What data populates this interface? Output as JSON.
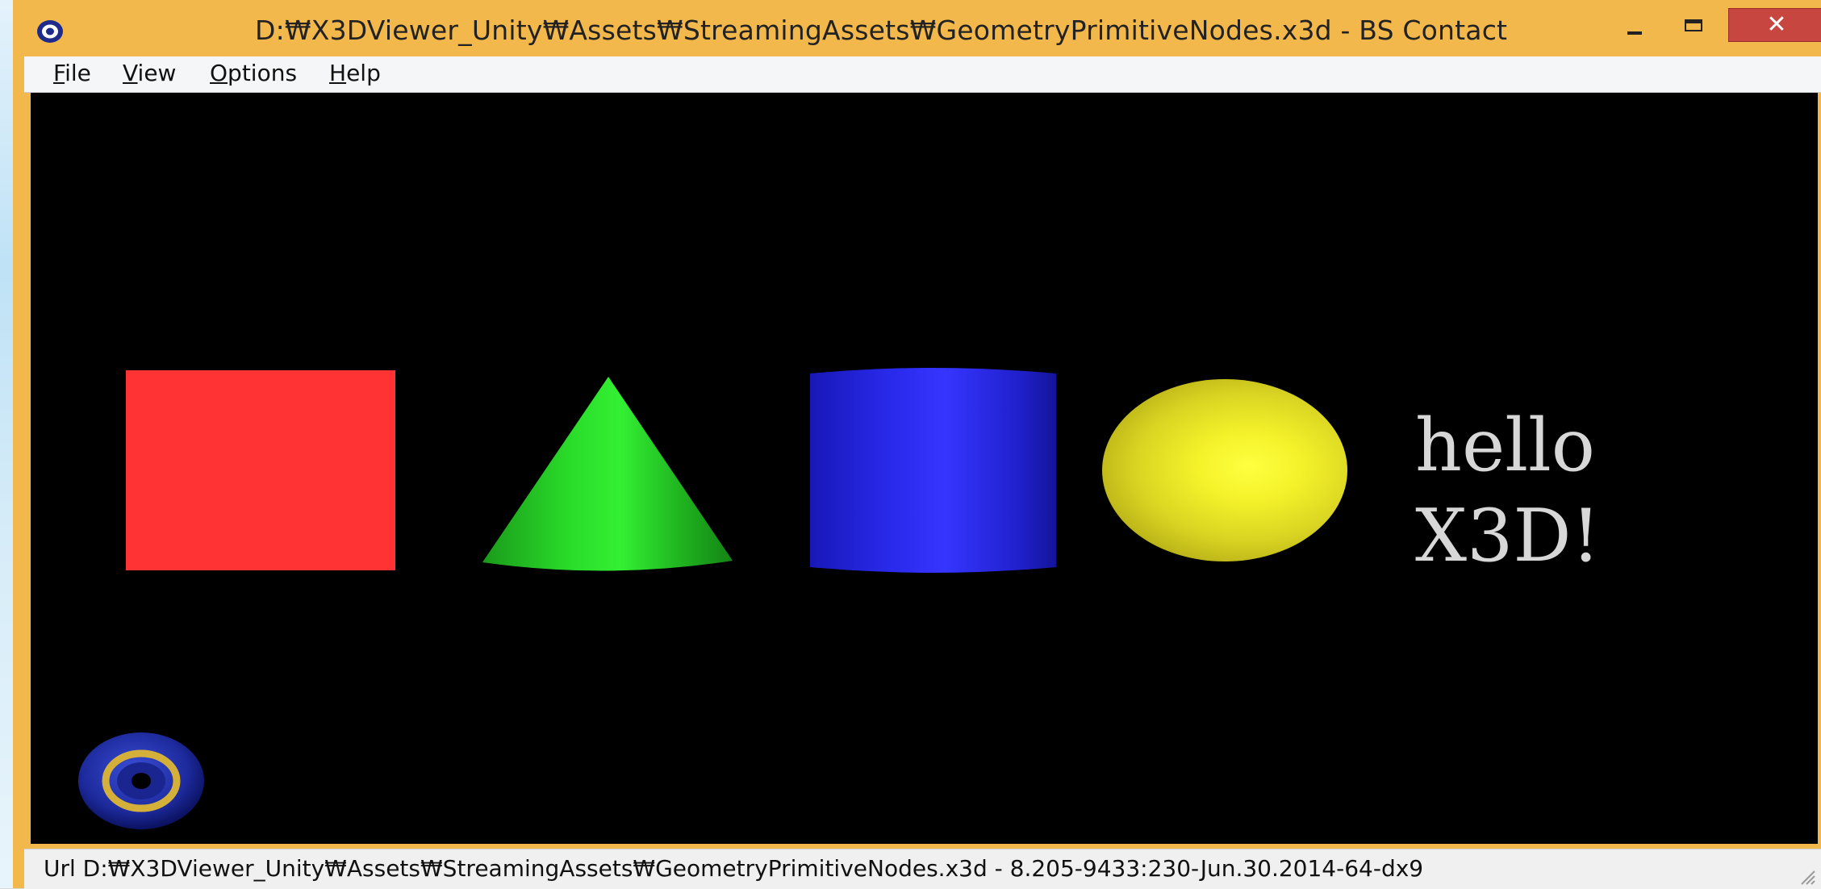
{
  "window": {
    "title": "D:₩X3DViewer_Unity₩Assets₩StreamingAssets₩GeometryPrimitiveNodes.x3d - BS Contact",
    "min_glyph": "−",
    "close_glyph": "✕",
    "app_icon": "bs-contact-eye-icon"
  },
  "menu": {
    "items": [
      {
        "mnemonic": "F",
        "rest": "ile"
      },
      {
        "mnemonic": "V",
        "rest": "iew"
      },
      {
        "mnemonic": "O",
        "rest": "ptions"
      },
      {
        "mnemonic": "H",
        "rest": "elp"
      }
    ]
  },
  "scene": {
    "background": "#000000",
    "objects": [
      {
        "name": "box",
        "color": "#ff3333"
      },
      {
        "name": "cone",
        "color": "#22cc22"
      },
      {
        "name": "cylinder",
        "color": "#2a2aff"
      },
      {
        "name": "sphere",
        "color": "#ffff33"
      }
    ],
    "text_lines": [
      "hello",
      "X3D!"
    ],
    "text_color": "#d7d7d7",
    "nav_widget_icon": "navigation-eye-icon"
  },
  "status": {
    "text": "Url D:₩X3DViewer_Unity₩Assets₩StreamingAssets₩GeometryPrimitiveNodes.x3d  -  8.205-9433:230-Jun.30.2014-64-dx9"
  },
  "colors": {
    "titlebar": "#f2b84b",
    "close_button": "#c7463f"
  }
}
